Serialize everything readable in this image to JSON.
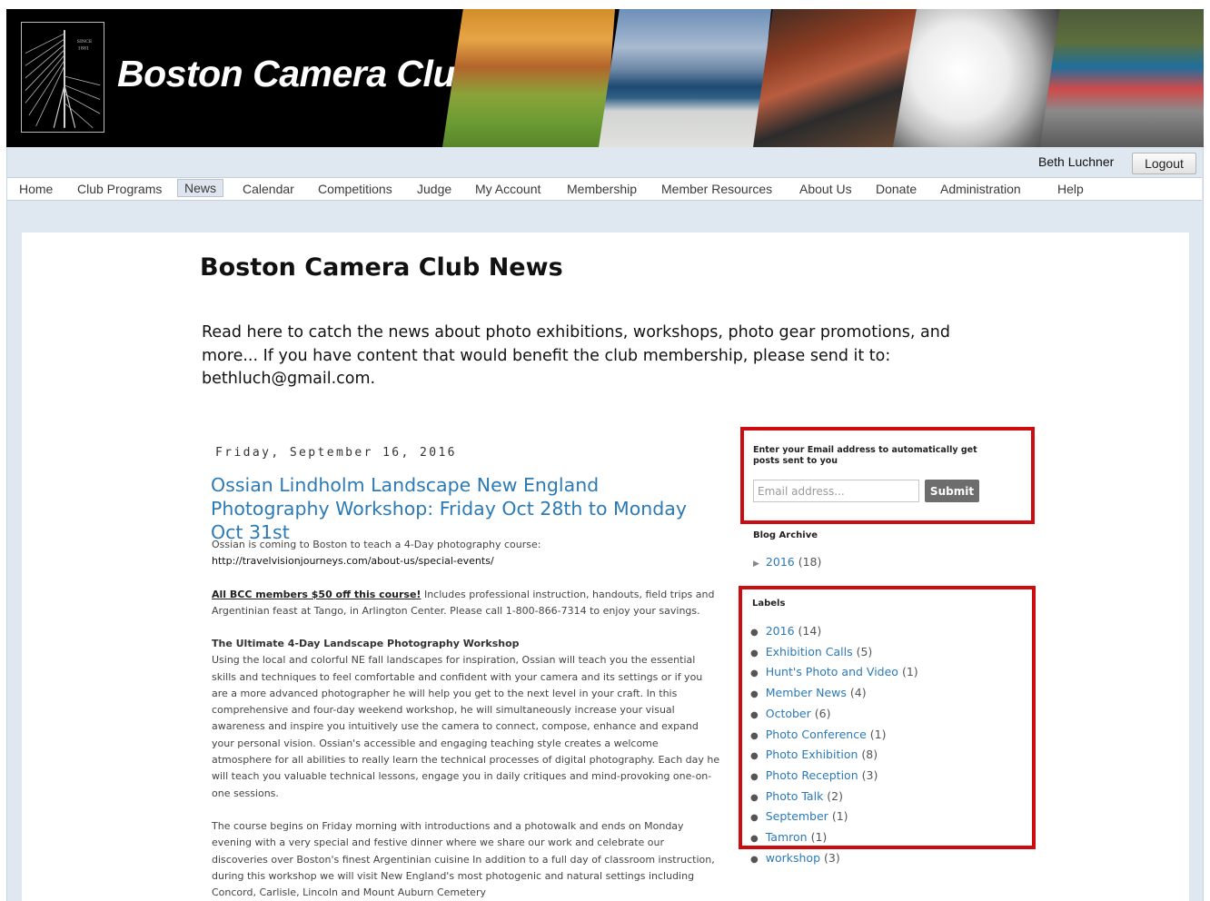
{
  "banner": {
    "title": "Boston Camera Club",
    "logo_line1": "SINCE",
    "logo_line2": "1881"
  },
  "user": {
    "name": "Beth Luchner",
    "logout_label": "Logout"
  },
  "nav": {
    "items": [
      {
        "label": "Home",
        "active": false
      },
      {
        "label": "Club Programs",
        "active": false
      },
      {
        "label": "News",
        "active": true
      },
      {
        "label": "Calendar",
        "active": false
      },
      {
        "label": "Competitions",
        "active": false
      },
      {
        "label": "Judge",
        "active": false
      },
      {
        "label": "My Account",
        "active": false
      },
      {
        "label": "Membership",
        "active": false
      },
      {
        "label": "Member Resources",
        "active": false
      },
      {
        "label": "About Us",
        "active": false
      },
      {
        "label": "Donate",
        "active": false
      },
      {
        "label": "Administration",
        "active": false
      },
      {
        "label": "Help",
        "active": false
      }
    ]
  },
  "page": {
    "title": "Boston Camera Club News",
    "intro": "Read here to catch the news about photo exhibitions, workshops, photo gear promotions, and more... If you have content that would benefit the club membership, please send it to: bethluch@gmail.com."
  },
  "post": {
    "date": "Friday, September 16, 2016",
    "title": "Ossian Lindholm Landscape New England Photography Workshop: Friday Oct 28th to Monday Oct 31st",
    "p1_text": "Ossian is coming to Boston to teach a 4-Day photography course: ",
    "p1_url": "http://travelvisionjourneys.com/about-us/special-events/",
    "p2_promo": "All BCC members $50 off this course!",
    "p2_text": " Includes professional instruction, handouts, field trips and Argentinian feast at Tango, in Arlington Center.  Please call 1-800-866-7314 to enjoy your savings.",
    "p3_heading": "The Ultimate 4-Day Landscape Photography Workshop",
    "p3_text": "Using the local and colorful NE fall landscapes for inspiration, Ossian will teach you the essential skills and techniques to feel comfortable and confident with your camera and its settings or if you are a more advanced photographer he will help you get to the next level in your craft. In this comprehensive and four-day weekend workshop, he will simultaneously increase your visual awareness and inspire you intuitively use the camera to connect, compose, enhance and expand your personal vision. Ossian's accessible and engaging teaching style creates a welcome atmosphere for all abilities to really learn the technical processes of digital photography. Each day he will teach you valuable technical lessons, engage you in daily critiques and mind-provoking one-on-one sessions.",
    "p4_text": "The course begins on Friday morning with introductions and a photowalk and ends on Monday evening with a very special and festive dinner where we share our work and celebrate our discoveries over Boston's finest Argentinian cuisine In addition to a full day of classroom instruction, during this workshop we will visit New England's most photogenic and natural settings including Concord, Carlisle, Lincoln and Mount Auburn Cemetery"
  },
  "subscribe": {
    "label": "Enter your Email address to automatically get posts sent to you",
    "placeholder": "Email address...",
    "submit_label": "Submit"
  },
  "archive": {
    "heading": "Blog Archive",
    "year": "2016",
    "count": "(18)"
  },
  "labels": {
    "heading": "Labels",
    "items": [
      {
        "name": "2016",
        "count": "(14)"
      },
      {
        "name": "Exhibition Calls",
        "count": "(5)"
      },
      {
        "name": "Hunt's Photo and Video",
        "count": "(1)"
      },
      {
        "name": "Member News",
        "count": "(4)"
      },
      {
        "name": "October",
        "count": "(6)"
      },
      {
        "name": "Photo Conference",
        "count": "(1)"
      },
      {
        "name": "Photo Exhibition",
        "count": "(8)"
      },
      {
        "name": "Photo Reception",
        "count": "(3)"
      },
      {
        "name": "Photo Talk",
        "count": "(2)"
      },
      {
        "name": "September",
        "count": "(1)"
      },
      {
        "name": "Tamron",
        "count": "(1)"
      },
      {
        "name": "workshop",
        "count": "(3)"
      }
    ]
  },
  "colors": {
    "link": "#2b7ab6",
    "highlight_box": "#cc0d10",
    "nav_background": "#dfe7f1",
    "banner_background": "#000000"
  }
}
